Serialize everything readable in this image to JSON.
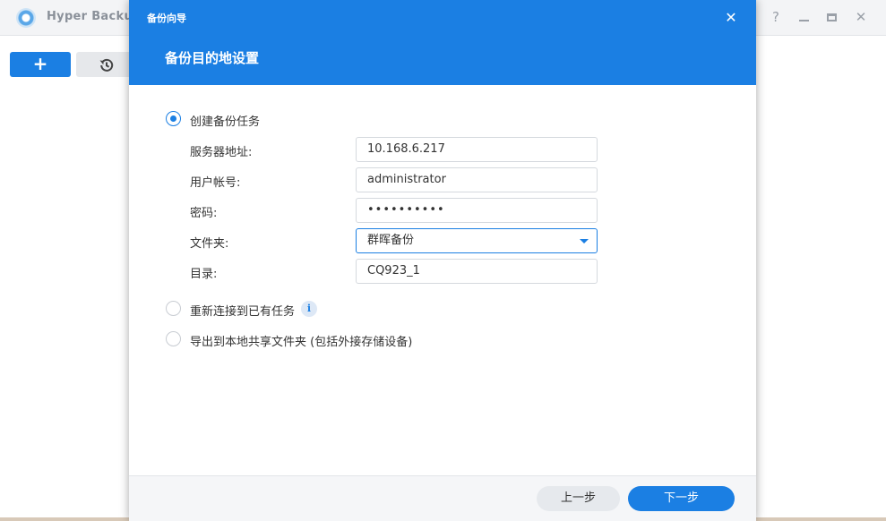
{
  "app": {
    "title": "Hyper Backup",
    "window_controls": {
      "help": "?",
      "close": "✕"
    }
  },
  "toolbar": {
    "add_label": "+",
    "restore_icon": "restore-history-icon"
  },
  "dialog": {
    "wizard_label": "备份向导",
    "title": "备份目的地设置",
    "close_label": "✕",
    "options": [
      {
        "label": "创建备份任务",
        "checked": true
      },
      {
        "label": "重新连接到已有任务",
        "checked": false
      },
      {
        "label": "导出到本地共享文件夹 (包括外接存储设备)",
        "checked": false
      }
    ],
    "fields": {
      "server": {
        "label": "服务器地址:",
        "value": "10.168.6.217"
      },
      "username": {
        "label": "用户帐号:",
        "value": "administrator"
      },
      "password": {
        "label": "密码:",
        "value": "••••••••••"
      },
      "folder": {
        "label": "文件夹:",
        "value": "群晖备份"
      },
      "directory": {
        "label": "目录:",
        "value": "CQ923_1"
      }
    },
    "info_icon": "i",
    "buttons": {
      "prev": "上一步",
      "next": "下一步"
    }
  },
  "colors": {
    "accent": "#1b7fe3",
    "footer": "#f5f6f8"
  }
}
